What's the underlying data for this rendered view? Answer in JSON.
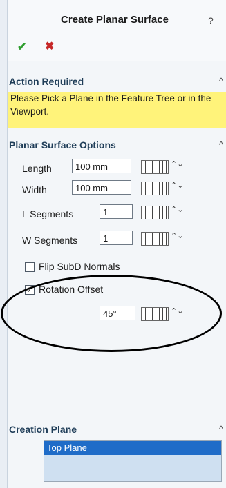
{
  "panel": {
    "title": "Create Planar Surface",
    "help_glyph": "?",
    "ok_glyph": "✔",
    "cancel_glyph": "✖"
  },
  "action_required": {
    "title": "Action Required",
    "collapse_glyph": "^",
    "message": "Please Pick a Plane in the Feature Tree or in the Viewport."
  },
  "options": {
    "title": "Planar Surface Options",
    "collapse_glyph": "^",
    "length_label": "Length",
    "length_value": "100 mm",
    "width_label": "Width",
    "width_value": "100 mm",
    "lseg_label": "L Segments",
    "lseg_value": "1",
    "wseg_label": "W Segments",
    "wseg_value": "1",
    "flip_label": "Flip SubD Normals",
    "flip_checked": false,
    "rotation_label": "Rotation Offset",
    "rotation_checked": true,
    "rotation_value": "45°",
    "spin_glyph": "⌃⌄"
  },
  "creation_plane": {
    "title": "Creation Plane",
    "collapse_glyph": "^",
    "selected": "Top Plane"
  }
}
